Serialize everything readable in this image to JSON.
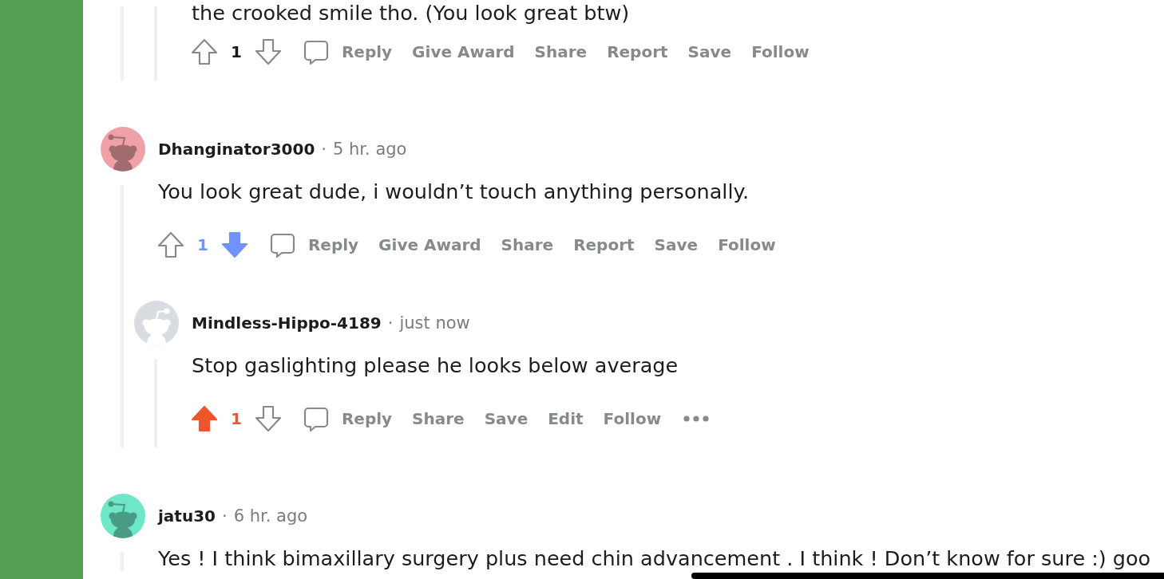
{
  "comments": [
    {
      "children": [
        {
          "body": "the crooked smile tho. (You look great btw)",
          "score": "1",
          "upvoted": false,
          "downvoted": false,
          "actions": [
            {
              "kind": "reply",
              "label": "Reply"
            },
            {
              "kind": "award",
              "label": "Give Award"
            },
            {
              "kind": "share",
              "label": "Share"
            },
            {
              "kind": "report",
              "label": "Report"
            },
            {
              "kind": "save",
              "label": "Save"
            },
            {
              "kind": "follow",
              "label": "Follow"
            }
          ]
        }
      ]
    },
    {
      "author": "Dhanginator3000",
      "separator": "·",
      "time": "5 hr. ago",
      "avatar": {
        "kind": "custom",
        "color": "#f0a1a8"
      },
      "body": "You look great dude, i wouldn’t touch anything personally.",
      "score": "1",
      "upvoted": false,
      "downvoted": true,
      "actions": [
        {
          "kind": "reply",
          "label": "Reply"
        },
        {
          "kind": "award",
          "label": "Give Award"
        },
        {
          "kind": "share",
          "label": "Share"
        },
        {
          "kind": "report",
          "label": "Report"
        },
        {
          "kind": "save",
          "label": "Save"
        },
        {
          "kind": "follow",
          "label": "Follow"
        }
      ],
      "children": [
        {
          "author": "Mindless-Hippo-4189",
          "separator": "·",
          "time": "just now",
          "avatar": {
            "kind": "default",
            "color": "#d9dde1"
          },
          "body": "Stop gaslighting please he looks below average",
          "score": "1",
          "upvoted": true,
          "downvoted": false,
          "actions": [
            {
              "kind": "reply",
              "label": "Reply"
            },
            {
              "kind": "share",
              "label": "Share"
            },
            {
              "kind": "save",
              "label": "Save"
            },
            {
              "kind": "edit",
              "label": "Edit"
            },
            {
              "kind": "follow",
              "label": "Follow"
            }
          ],
          "more_menu": true
        }
      ]
    },
    {
      "author": "jatu30",
      "separator": "·",
      "time": "6 hr. ago",
      "avatar": {
        "kind": "custom",
        "color": "#6ee7c6"
      },
      "body": "Yes ! I think bimaxillary surgery plus need chin advancement . I think ! Don’t know for sure :) goo"
    }
  ]
}
